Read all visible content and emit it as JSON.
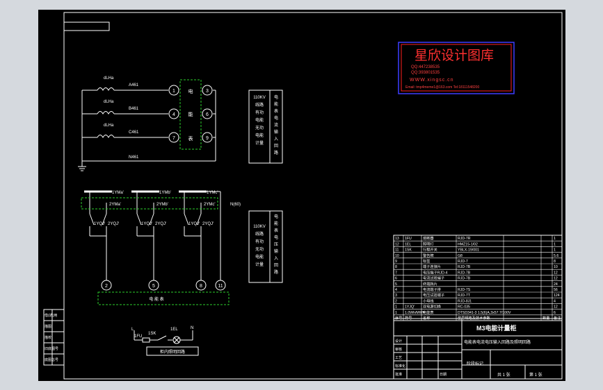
{
  "watermark": {
    "title": "星欣设计图库",
    "qq1": "QQ:447238535",
    "qq2": "QQ:393801535",
    "url": "WWW.xingsc.cn",
    "email": "Email:  tmp4meme1@163.com Tel:18111548200"
  },
  "ct": {
    "label": "dLHa",
    "lines": [
      "A461",
      "B461",
      "C461",
      "N461"
    ]
  },
  "meter": {
    "left_terminals": [
      "1",
      "4",
      "7"
    ],
    "right_terminals": [
      "3",
      "6",
      "9"
    ],
    "chars": [
      "电",
      "能",
      "表"
    ]
  },
  "box1": {
    "chars": [
      "110KV",
      "线路",
      "有功",
      "电能",
      "无功",
      "电能",
      "计量"
    ],
    "title_chars": [
      "电",
      "能",
      "表",
      "电",
      "流",
      "输",
      "入",
      "回",
      "路"
    ]
  },
  "voltage": {
    "top_labels": [
      "1YMa'",
      "1YMb'",
      "1YMc'"
    ],
    "dashed_labels": [
      "2YMa'",
      "2YMb'",
      "2YMc'"
    ],
    "nl": "N(60)",
    "switch_labels": [
      "1YQJ'",
      "2YQJ'",
      "1YQJ'",
      "2YQJ'",
      "1YQJ'",
      "2YQJ'"
    ]
  },
  "box2": {
    "chars": [
      "110KV",
      "线路",
      "有功",
      "无功",
      "电能",
      "计量"
    ],
    "title_chars": [
      "电",
      "能",
      "表",
      "电",
      "压",
      "输",
      "入",
      "回",
      "路"
    ]
  },
  "meter_bottom": {
    "terminals": [
      "2",
      "5",
      "8",
      "11"
    ],
    "label": "电  能  表"
  },
  "lamp": {
    "l": "L",
    "n": "N",
    "fuse": "1FU",
    "switch": "1SK",
    "lamp": "1EL",
    "caption": "柜内照明回路"
  },
  "bom": {
    "rows": [
      [
        "13",
        "1FU",
        "熔断器",
        "RJD-7R",
        "",
        "1"
      ],
      [
        "12",
        "1EL",
        "照明灯",
        "HMZ15-1/02",
        "",
        "1"
      ],
      [
        "11",
        "1SK",
        "行程开关",
        "YBLX-19/001",
        "",
        "1"
      ],
      [
        "10",
        "",
        "警告牌",
        "G8",
        "",
        "5.6"
      ],
      [
        "9",
        "",
        "标签",
        "RJD-7",
        "",
        "8"
      ],
      [
        "8",
        "",
        "端子连接片",
        "RJD-7B",
        "",
        "10"
      ],
      [
        "7",
        "",
        "电压端子RJD-4",
        "RJD-7B",
        "",
        "12"
      ],
      [
        "6",
        "",
        "电流试验端子",
        "RJD-7B",
        "",
        "12"
      ],
      [
        "5",
        "",
        "终端挡片",
        "",
        "",
        "24"
      ],
      [
        "4",
        "",
        "电流端子排",
        "RJD-7S",
        "",
        "56"
      ],
      [
        "3",
        "",
        "电压试验端子",
        "RJD-7T",
        "",
        "124"
      ],
      [
        "2",
        "",
        "小母线",
        "RJD-8J1",
        "",
        "4"
      ],
      [
        "1",
        "1YJQ'",
        "双电源切换",
        "RC-035",
        "",
        "12"
      ],
      [
        "1",
        "1.0Wh/MWh",
        "电能表",
        "DTSD341-3 1.5(6)A,3x57.7/100V",
        "",
        "6"
      ]
    ],
    "header": [
      "序号",
      "符号",
      "名称",
      "型号规格及技术参数",
      "数量",
      "备注"
    ]
  },
  "title_block": {
    "drawing_title": "M3电能计量柜",
    "subtitle": "电能表电流电压输入回路及照明回路",
    "scale": "第 1 张",
    "sheets": "共 1 张",
    "labels": [
      "设计",
      "审核",
      "工艺",
      "标准化",
      "批准",
      "日期"
    ]
  },
  "side_table": {
    "labels": [
      "借(通)用",
      "描图",
      "描校",
      "旧底图号",
      "底图总号"
    ]
  }
}
